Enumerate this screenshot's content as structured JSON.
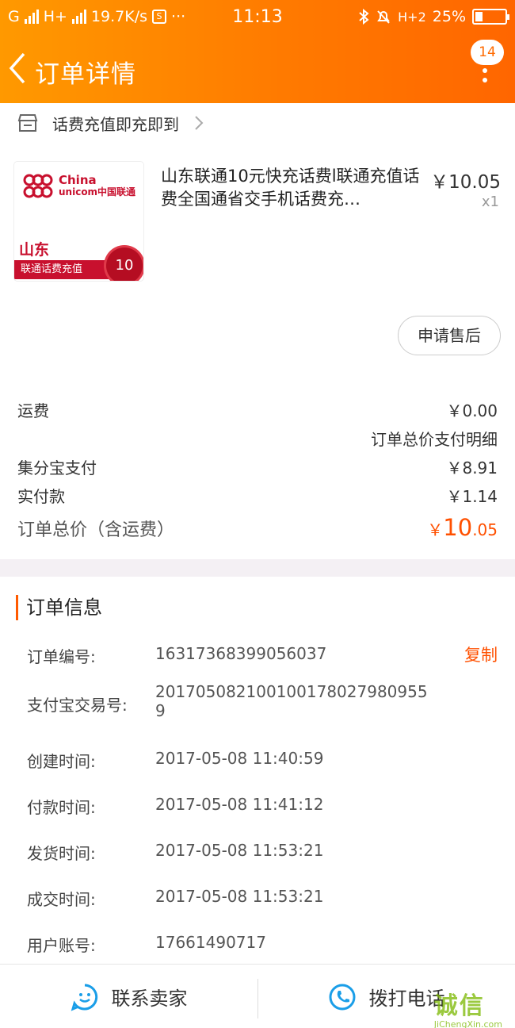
{
  "status_bar": {
    "carrier": "G",
    "network": "H+",
    "speed": "19.7K/s",
    "s_badge": "S",
    "more": "···",
    "time": "11:13",
    "signal2": "H+2",
    "battery": "25%"
  },
  "nav": {
    "back_icon": "chevron-left-icon",
    "title": "订单详情",
    "badge": "14",
    "more_icon": "vertical-dots-icon"
  },
  "shop": {
    "icon": "shop-icon",
    "name": "话费充值即充即到"
  },
  "product": {
    "thumb": {
      "logo_text_1": "China",
      "logo_text_2": "unicom中国联通",
      "province": "山东",
      "banner": "联通话费充值",
      "seal": "10"
    },
    "title": "山东联通10元快充话费l联通充值话费全国通省交手机话费充…",
    "price": "￥10.05",
    "qty": "x1"
  },
  "after_sale_label": "申请售后",
  "fees": {
    "shipping_label": "运费",
    "shipping_value": "￥0.00",
    "detail_link": "订单总价支付明细",
    "jifenbao_label": "集分宝支付",
    "jifenbao_value": "￥8.91",
    "paid_label": "实付款",
    "paid_value": "￥1.14",
    "total_label": "订单总价（含运费）",
    "total_currency": "￥",
    "total_int": "10",
    "total_dec": ".05"
  },
  "order_info": {
    "title": "订单信息",
    "copy_label": "复制",
    "rows": [
      {
        "key": "订单编号:",
        "value": "16317368399056037"
      },
      {
        "key": "支付宝交易号:",
        "value": "2017050821001001780279809559"
      },
      {
        "key": "创建时间:",
        "value": "2017-05-08 11:40:59"
      },
      {
        "key": "付款时间:",
        "value": "2017-05-08 11:41:12"
      },
      {
        "key": "发货时间:",
        "value": "2017-05-08 11:53:21"
      },
      {
        "key": "成交时间:",
        "value": "2017-05-08 11:53:21"
      },
      {
        "key": "用户账号:",
        "value": "17661490717"
      }
    ]
  },
  "bottom_bar": {
    "contact_seller": "联系卖家",
    "contact_icon": "chat-face-icon",
    "call_phone": "拨打电话",
    "call_icon": "phone-icon"
  },
  "watermark": {
    "logo": "诚信",
    "url": "JiChengXin.com"
  },
  "colors": {
    "header_start": "#ff9900",
    "header_end": "#ff6600",
    "accent": "#ff5000",
    "icon_blue": "#1a9ee8"
  }
}
